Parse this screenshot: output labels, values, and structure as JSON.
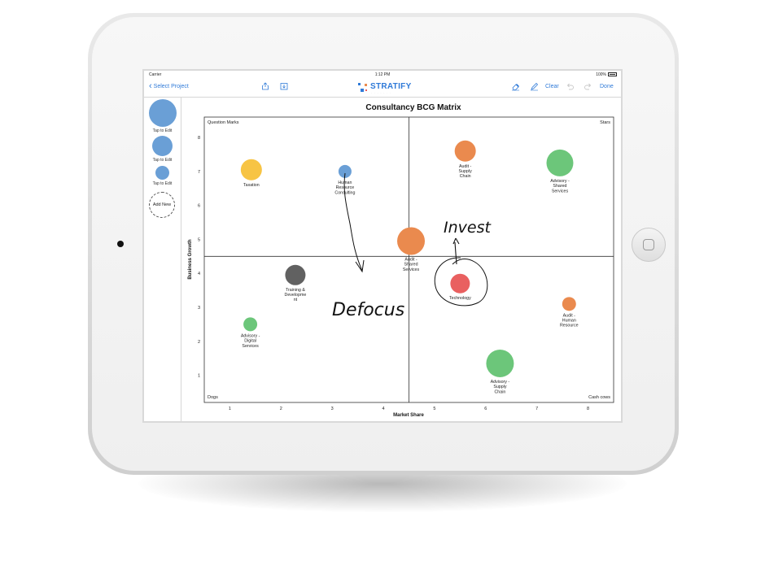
{
  "status_bar": {
    "carrier": "Carrier",
    "time": "1:12 PM",
    "battery": "100%"
  },
  "nav": {
    "back_label": "Select Project",
    "logo_text": "STRATIFY",
    "clear_label": "Clear",
    "done_label": "Done"
  },
  "sidebar": {
    "items": [
      {
        "label": "Tap to Edit",
        "size": "large"
      },
      {
        "label": "Tap to Edit",
        "size": "medium"
      },
      {
        "label": "Tap to Edit",
        "size": "small"
      }
    ],
    "add_new_label": "Add New"
  },
  "colors": {
    "accent": "#2f7ad8",
    "yellow": "#f7c444",
    "blue": "#6a9fd6",
    "orange": "#ea8a4e",
    "green": "#6cc67a",
    "grey": "#616161",
    "red": "#e96060"
  },
  "chart_data": {
    "type": "scatter",
    "title": "Consultancy BCG Matrix",
    "xlabel": "Market Share",
    "ylabel": "Business Growth",
    "xlim": [
      0.5,
      8.5
    ],
    "ylim": [
      0.2,
      8.6
    ],
    "x_ticks": [
      1,
      2,
      3,
      4,
      5,
      6,
      7,
      8
    ],
    "y_ticks": [
      1,
      2,
      3,
      4,
      5,
      6,
      7,
      8
    ],
    "divider_x": 4.5,
    "divider_y": 4.5,
    "quadrants": {
      "top_left": "Question Marks",
      "top_right": "Stars",
      "bottom_left": "Dogs",
      "bottom_right": "Cash cows"
    },
    "points": [
      {
        "label": [
          "Taxation"
        ],
        "x": 1.42,
        "y": 7.05,
        "r": 13,
        "color": "yellow"
      },
      {
        "label": [
          "Human",
          "Resource",
          "Consulting"
        ],
        "x": 3.25,
        "y": 7.0,
        "r": 8,
        "color": "blue"
      },
      {
        "label": [
          "Audit -",
          "Supply",
          "Chain"
        ],
        "x": 5.6,
        "y": 7.6,
        "r": 13,
        "color": "orange"
      },
      {
        "label": [
          "Advisory -",
          "Shared",
          "Services"
        ],
        "x": 7.45,
        "y": 7.25,
        "r": 16.5,
        "color": "green"
      },
      {
        "label": [
          "Audit -",
          "Shared",
          "Services"
        ],
        "x": 4.54,
        "y": 4.95,
        "r": 17,
        "color": "orange"
      },
      {
        "label": [
          "Training &",
          "Developme",
          "nt"
        ],
        "x": 2.28,
        "y": 3.95,
        "r": 12.5,
        "color": "grey"
      },
      {
        "label": [
          "Technology"
        ],
        "x": 5.5,
        "y": 3.7,
        "r": 12,
        "color": "red"
      },
      {
        "label": [
          "Audit -",
          "Human",
          "Resource"
        ],
        "x": 7.63,
        "y": 3.1,
        "r": 8.5,
        "color": "orange"
      },
      {
        "label": [
          "Advisory -",
          "Digital",
          "Services"
        ],
        "x": 1.4,
        "y": 2.5,
        "r": 8.5,
        "color": "green"
      },
      {
        "label": [
          "Advisory -",
          "Supply",
          "Chain"
        ],
        "x": 6.28,
        "y": 1.35,
        "r": 17,
        "color": "green"
      }
    ],
    "annotations": {
      "invest": "Invest",
      "defocus": "Defocus"
    }
  }
}
